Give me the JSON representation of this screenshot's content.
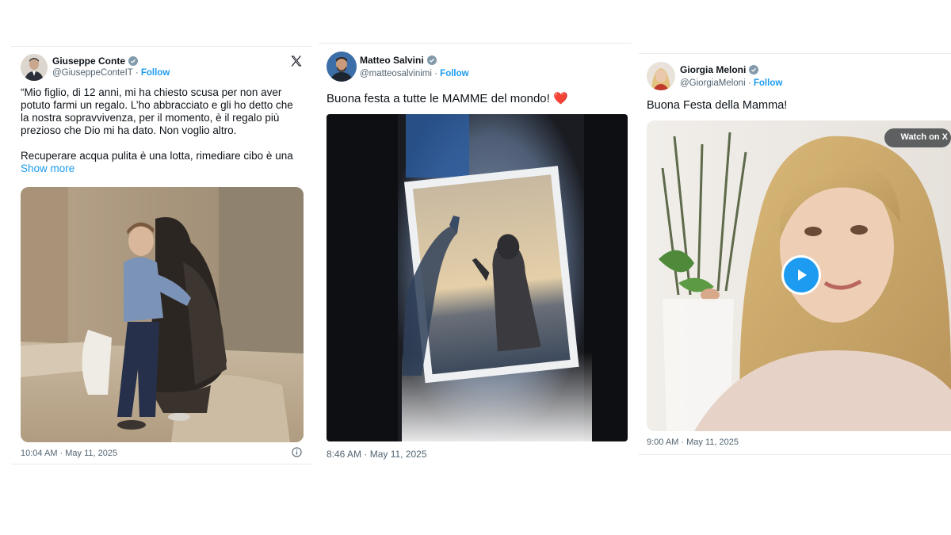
{
  "tweets": [
    {
      "name": "Giuseppe Conte",
      "handle": "@GiuseppeConteIT",
      "separator": "·",
      "follow_label": "Follow",
      "text_p1": "“Mio figlio, di 12 anni, mi ha chiesto scusa per non aver potuto farmi un regalo. L’ho abbracciato e gli ho detto che la nostra sopravvivenza, per il momento, è il regalo più prezioso che Dio mi ha dato. Non voglio altro.",
      "text_p2": "Recuperare acqua pulita è una lotta, rimediare cibo è una",
      "show_more_label": "Show more",
      "timestamp": "10:04 AM · May 11, 2025",
      "logo_icon": "x-logo-icon",
      "info_icon": "info-icon"
    },
    {
      "name": "Matteo Salvini",
      "handle": "@matteosalvinimi",
      "separator": "·",
      "follow_label": "Follow",
      "text": "Buona festa a tutte le MAMME del mondo!",
      "emoji": "❤️",
      "timestamp": "8:46 AM · May 11, 2025"
    },
    {
      "name": "Giorgia Meloni",
      "handle": "@GiorgiaMeloni",
      "separator": "·",
      "follow_label": "Follow",
      "text": "Buona Festa della Mamma!",
      "watch_label": "Watch on X",
      "timestamp": "9:00 AM · May 11, 2025"
    }
  ],
  "colors": {
    "link": "#1d9bf0",
    "secondary_text": "#536471",
    "verified": "#829aab",
    "divider": "#e6ecf0"
  }
}
